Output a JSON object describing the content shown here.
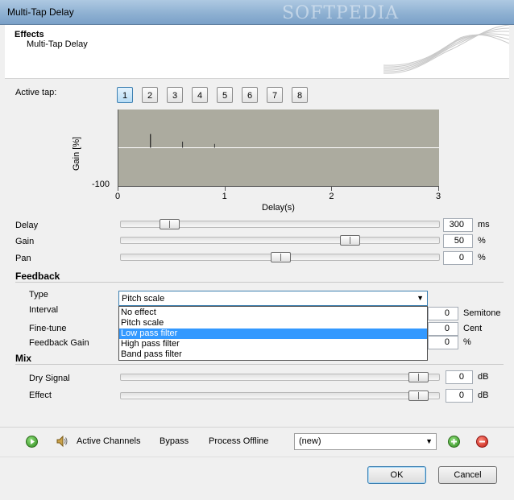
{
  "window": {
    "title": "Multi-Tap Delay",
    "watermark": "SOFTPEDIA"
  },
  "header": {
    "category": "Effects",
    "effect": "Multi-Tap Delay"
  },
  "taps": {
    "label": "Active tap:",
    "items": [
      "1",
      "2",
      "3",
      "4",
      "5",
      "6",
      "7",
      "8"
    ],
    "active": "1"
  },
  "chart_data": {
    "type": "line",
    "ylabel": "Gain [%]",
    "xlabel": "Delay(s)",
    "ytick": "-100",
    "xticks": [
      "0",
      "1",
      "2",
      "3"
    ],
    "xlim": [
      0,
      3
    ],
    "ylim": [
      -100,
      100
    ],
    "taps": [
      {
        "x": 0.3,
        "y": 18
      },
      {
        "x": 0.6,
        "y": 8
      },
      {
        "x": 0.9,
        "y": 5
      }
    ]
  },
  "params": [
    {
      "label": "Delay",
      "value": "300",
      "unit": "ms",
      "level": 0.13
    },
    {
      "label": "Gain",
      "value": "50",
      "unit": "%",
      "level": 0.73
    },
    {
      "label": "Pan",
      "value": "0",
      "unit": "%",
      "level": 0.5
    }
  ],
  "feedback": {
    "title": "Feedback",
    "type_label": "Type",
    "type_value": "Pitch scale",
    "options": [
      "No effect",
      "Pitch scale",
      "Low pass filter",
      "High pass filter",
      "Band pass filter"
    ],
    "highlighted": "Low pass filter",
    "interval_label": "Interval",
    "interval_value": "0",
    "interval_unit": "Semitone",
    "finetune_label": "Fine-tune",
    "finetune_value": "0",
    "finetune_unit": "Cent",
    "gain_label": "Feedback Gain",
    "gain_value": "0",
    "gain_unit": "%"
  },
  "mix": {
    "title": "Mix",
    "dry_label": "Dry Signal",
    "dry_value": "0",
    "dry_unit": "dB",
    "dry_level": 0.96,
    "effect_label": "Effect",
    "effect_value": "0",
    "effect_unit": "dB",
    "effect_level": 0.96
  },
  "toolbar": {
    "active_channels": "Active Channels",
    "bypass": "Bypass",
    "process_offline": "Process Offline",
    "preset": "(new)"
  },
  "buttons": {
    "ok": "OK",
    "cancel": "Cancel"
  },
  "colors": {
    "plot_bg": "#acab9f",
    "highlight": "#3399ff",
    "play": "#3a9a2a",
    "add": "#3a9a2a",
    "remove": "#d02020"
  }
}
